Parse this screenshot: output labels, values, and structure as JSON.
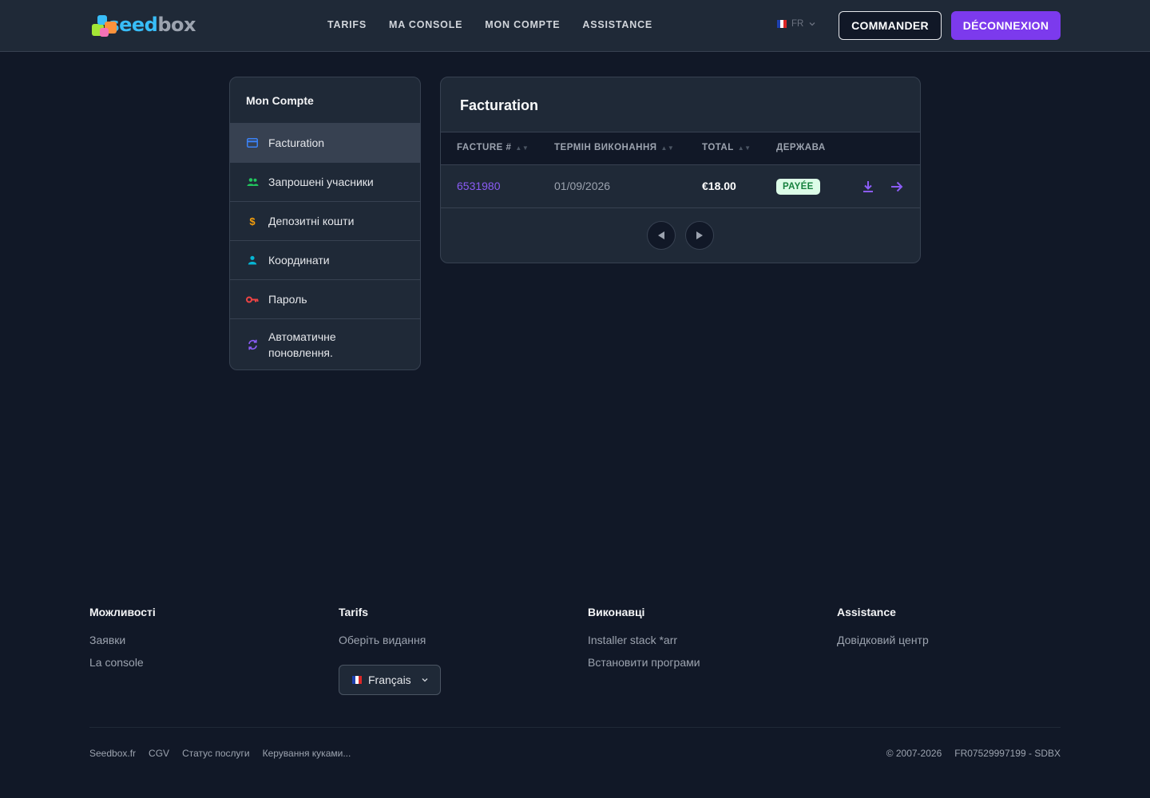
{
  "header": {
    "logo_seed": "seed",
    "logo_box": "box",
    "nav": [
      "TARIFS",
      "MA CONSOLE",
      "MON COMPTE",
      "ASSISTANCE"
    ],
    "lang_code": "FR",
    "commander_label": "COMMANDER",
    "logout_label": "DÉCONNEXION"
  },
  "sidebar": {
    "title": "Mon Compte",
    "items": [
      {
        "label": "Facturation",
        "icon": "credit-card-icon",
        "color": "#3b82f6",
        "active": true
      },
      {
        "label": "Запрошені учасники",
        "icon": "users-icon",
        "color": "#22c55e"
      },
      {
        "label": "Депозитні кошти",
        "icon": "dollar-icon",
        "color": "#f59e0b"
      },
      {
        "label": "Координати",
        "icon": "user-icon",
        "color": "#06b6d4"
      },
      {
        "label": "Пароль",
        "icon": "key-icon",
        "color": "#ef4444"
      },
      {
        "label": "Автоматичне поновлення.",
        "icon": "refresh-icon",
        "color": "#8b5cf6"
      }
    ]
  },
  "main": {
    "title": "Facturation",
    "columns": [
      "FACTURE #",
      "ТЕРМІН ВИКОНАННЯ",
      "TOTAL",
      "ДЕРЖАВА"
    ],
    "rows": [
      {
        "invoice": "6531980",
        "due_date": "01/09/2026",
        "total": "€18.00",
        "status": "PAYÉE"
      }
    ]
  },
  "footer": {
    "columns": [
      {
        "title": "Можливості",
        "links": [
          "Заявки",
          "La console"
        ]
      },
      {
        "title": "Tarifs",
        "links": [
          "Оберіть видання"
        ]
      },
      {
        "title": "Виконавці",
        "links": [
          "Installer stack *arr",
          "Встановити програми"
        ]
      },
      {
        "title": "Assistance",
        "links": [
          "Довідковий центр"
        ]
      }
    ],
    "language_select": "Français",
    "bottom_links": [
      "Seedbox.fr",
      "CGV",
      "Статус послуги",
      "Керування куками..."
    ],
    "copyright": "© 2007-2026",
    "company_id": "FR07529997199 - SDBX"
  },
  "colors": {
    "accent": "#7c3aed",
    "link": "#8b5cf6",
    "paid_badge_bg": "#dcfce7",
    "paid_badge_text": "#15803d"
  }
}
